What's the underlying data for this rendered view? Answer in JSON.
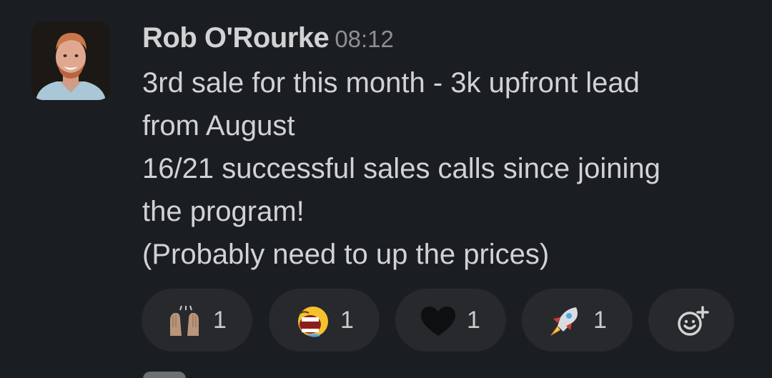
{
  "message": {
    "author": "Rob O'Rourke",
    "time": "08:12",
    "lines": [
      "3rd sale for this month - 3k upfront lead",
      "from August",
      "16/21 successful sales calls since joining",
      "the program!",
      "(Probably need to up the prices)"
    ]
  },
  "reactions": [
    {
      "icon": "raising-hands-icon",
      "count": "1"
    },
    {
      "icon": "laughing-face-icon",
      "count": "1"
    },
    {
      "icon": "black-heart-icon",
      "count": "1"
    },
    {
      "icon": "rocket-icon",
      "count": "1"
    }
  ],
  "add_reaction": {
    "icon": "add-reaction-icon"
  },
  "colors": {
    "background": "#1a1d21",
    "text": "#d1d2d3",
    "timestamp": "#8e8f91",
    "pill": "#27292d"
  }
}
